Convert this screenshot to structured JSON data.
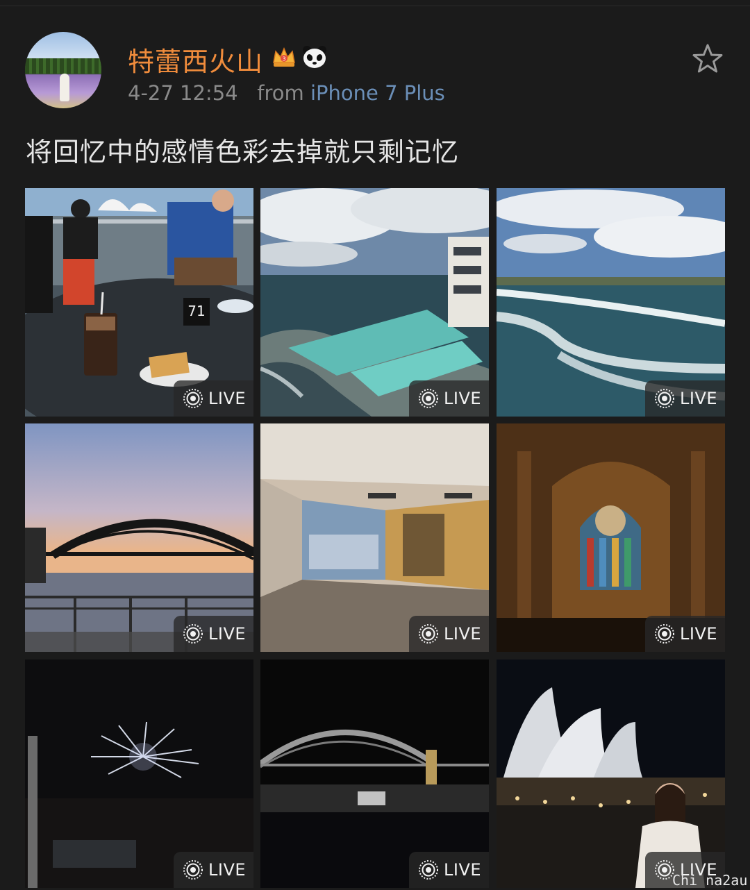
{
  "post": {
    "username": "特蕾西火山",
    "timestamp": "4-27 12:54",
    "from_label": "from",
    "device": "iPhone 7 Plus",
    "text": "将回忆中的感情色彩去掉就只剩记忆"
  },
  "icons": {
    "vip_badge": "crown-badge-icon",
    "panda_badge": "panda-badge-icon",
    "favorite": "star-outline-icon",
    "live": "live-photo-icon"
  },
  "photos": [
    {
      "live_label": "LIVE"
    },
    {
      "live_label": "LIVE"
    },
    {
      "live_label": "LIVE"
    },
    {
      "live_label": "LIVE"
    },
    {
      "live_label": "LIVE"
    },
    {
      "live_label": "LIVE"
    },
    {
      "live_label": "LIVE"
    },
    {
      "live_label": "LIVE"
    },
    {
      "live_label": "LIVE"
    }
  ],
  "watermark": "Chi na2au",
  "colors": {
    "background": "#1b1b1b",
    "username": "#f08c3c",
    "device_link": "#6b8fb8",
    "meta_text": "#8a8a8a",
    "body_text": "#e6e6e6"
  }
}
